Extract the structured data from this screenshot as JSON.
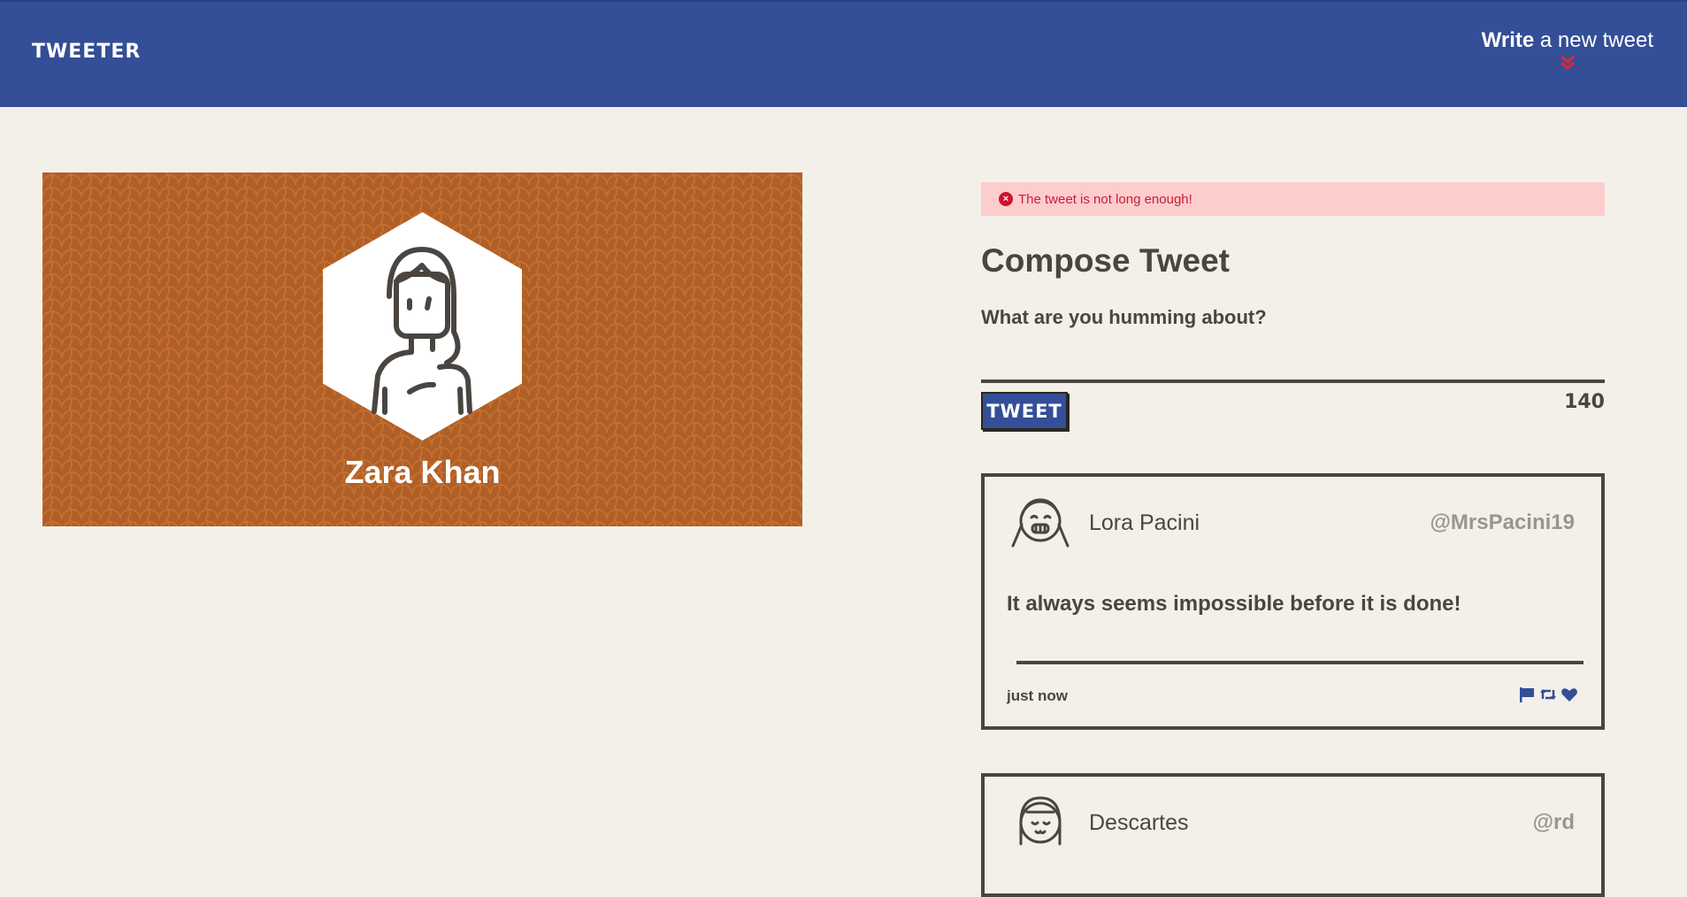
{
  "nav": {
    "brand": "TWEETER",
    "write_strong": "Write",
    "write_rest": " a new tweet",
    "accent_color": "#344e97"
  },
  "profile": {
    "name": "Zara Khan",
    "banner_color": "#b05f27"
  },
  "compose": {
    "error": "The tweet is not long enough!",
    "title": "Compose Tweet",
    "label": "What are you humming about?",
    "input_value": "",
    "button_label": "TWEET",
    "counter": "140"
  },
  "tweets": [
    {
      "name": "Lora Pacini",
      "handle": "@MrsPacini19",
      "text": "It always seems impossible before it is done!",
      "time": "just now",
      "actions": [
        "flag-icon",
        "retweet-icon",
        "heart-icon"
      ]
    },
    {
      "name": "Descartes",
      "handle": "@rd"
    }
  ]
}
